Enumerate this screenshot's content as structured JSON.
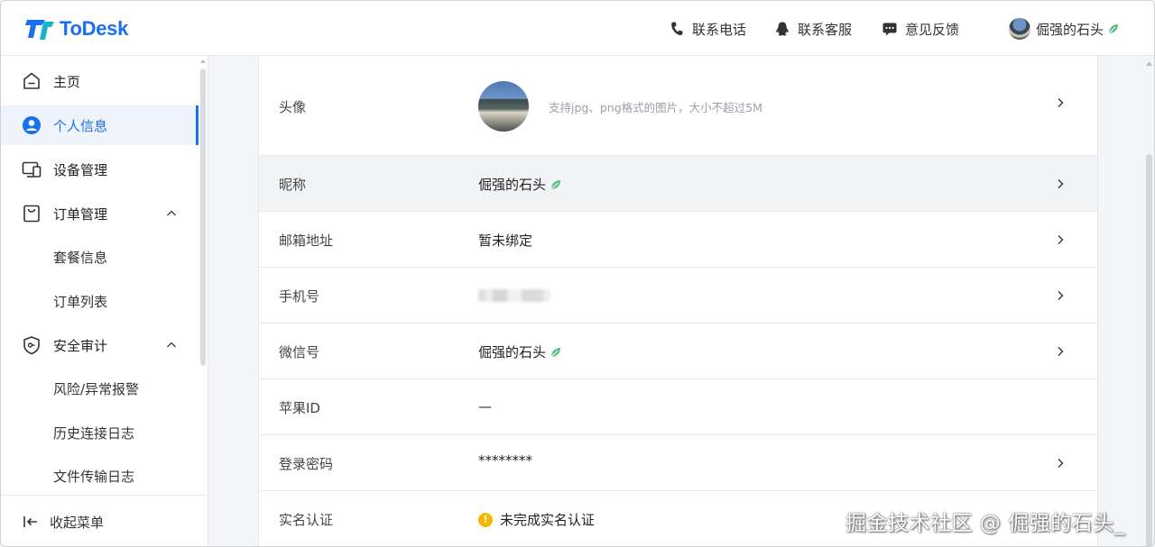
{
  "app": {
    "name": "ToDesk",
    "brand_color": "#1a6ff0"
  },
  "header": {
    "phone_label": "联系电话",
    "service_label": "联系客服",
    "feedback_label": "意见反馈",
    "username": "倔强的石头"
  },
  "sidebar": {
    "items": [
      {
        "label": "主页",
        "icon": "home-icon"
      },
      {
        "label": "个人信息",
        "icon": "user-icon",
        "active": true
      },
      {
        "label": "设备管理",
        "icon": "devices-icon"
      },
      {
        "label": "订单管理",
        "icon": "bag-icon",
        "expanded": true
      },
      {
        "label": "安全审计",
        "icon": "shield-icon",
        "expanded": true
      }
    ],
    "order_sub": [
      "套餐信息",
      "订单列表"
    ],
    "security_sub": [
      "风险/异常报警",
      "历史连接日志",
      "文件传输日志"
    ],
    "collapse_label": "收起菜单"
  },
  "profile": {
    "avatar_label": "头像",
    "avatar_hint": "支持jpg、png格式的图片，大小不超过5M",
    "nickname_label": "昵称",
    "nickname": "倔强的石头",
    "email_label": "邮箱地址",
    "email_value": "暂未绑定",
    "phone_label": "手机号",
    "wechat_label": "微信号",
    "wechat_value": "倔强的石头",
    "appleid_label": "苹果ID",
    "appleid_value": "—",
    "password_label": "登录密码",
    "password_value": "********",
    "realname_label": "实名认证",
    "realname_value": "未完成实名认证"
  },
  "watermark": "掘金技术社区 @ 倔强的石头_"
}
